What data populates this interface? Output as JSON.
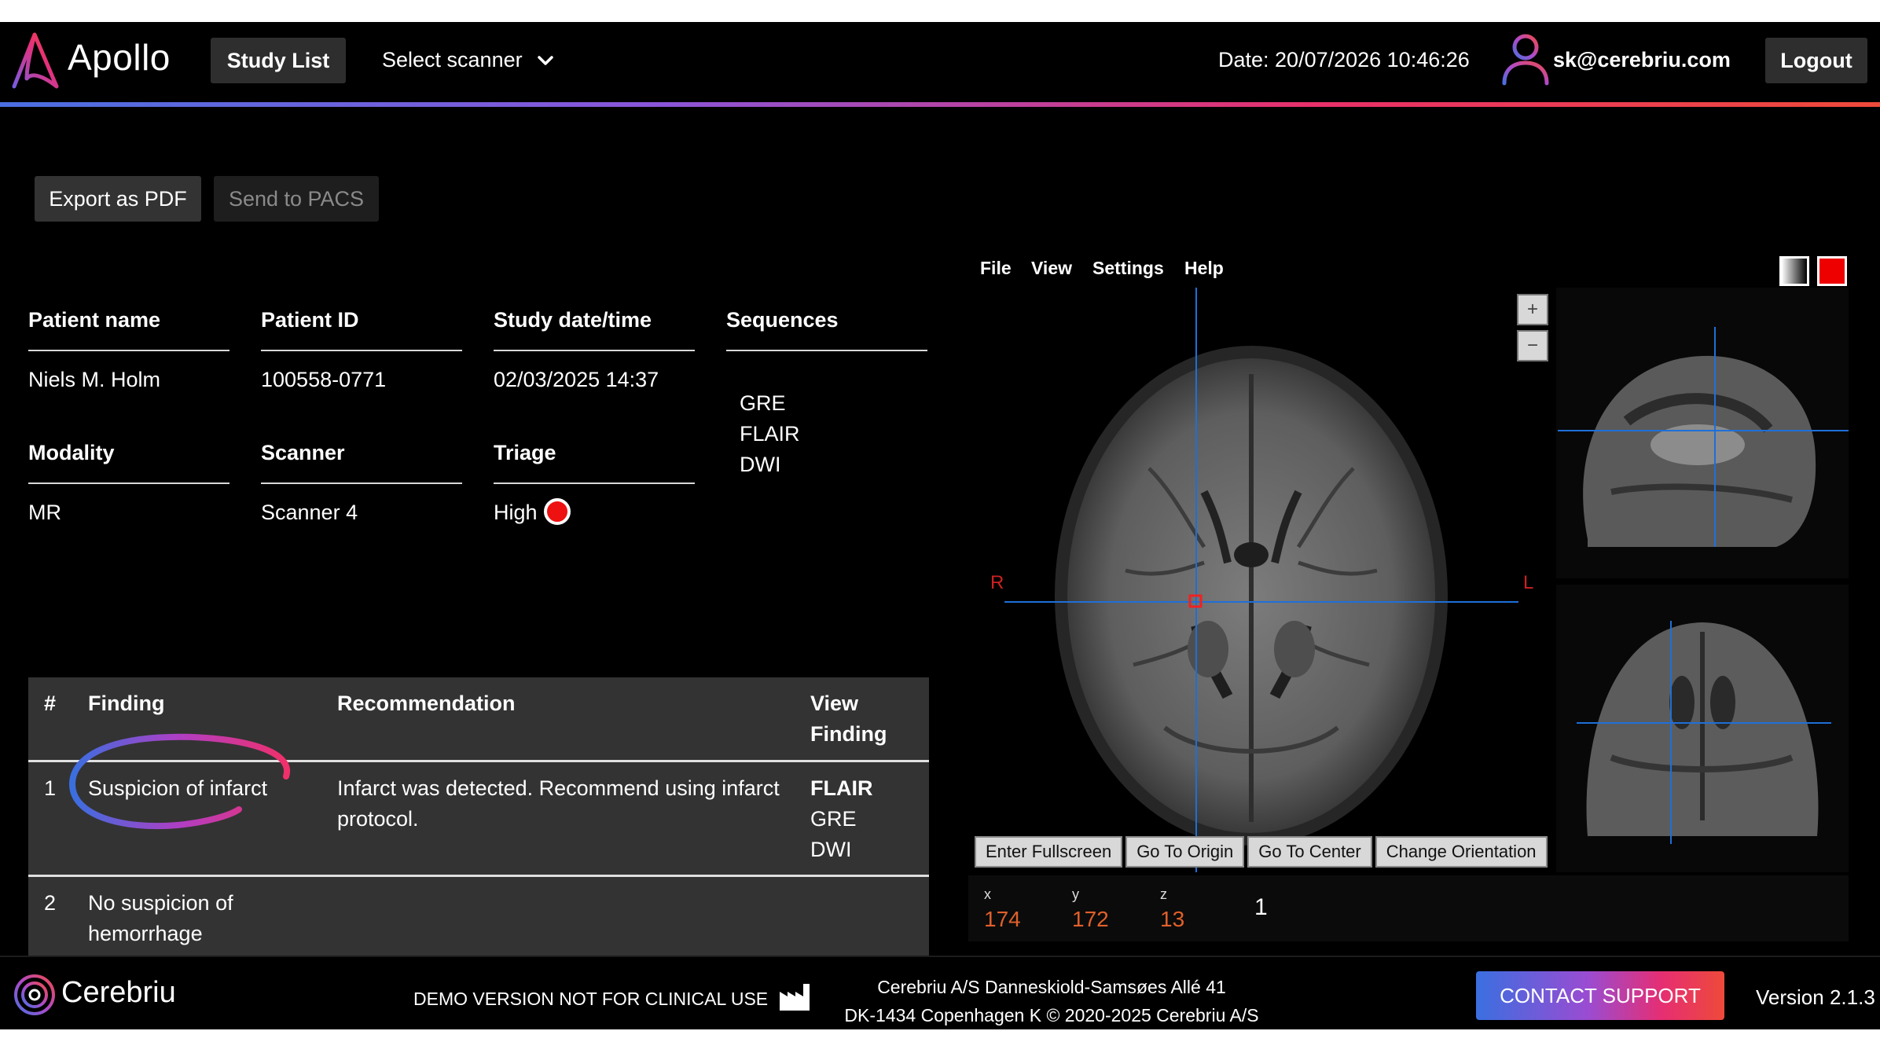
{
  "header": {
    "brand": "Apollo",
    "study_list_label": "Study List",
    "scanner_select_label": "Select scanner",
    "date_text": "Date: 20/07/2026 10:46:26",
    "user_email": "sk@cerebriu.com",
    "logout_label": "Logout"
  },
  "actions": {
    "export_pdf": "Export as PDF",
    "send_pacs": "Send to PACS"
  },
  "patient_info": {
    "patient_name_label": "Patient name",
    "patient_name": "Niels M. Holm",
    "patient_id_label": "Patient ID",
    "patient_id": "100558-0771",
    "study_datetime_label": "Study date/time",
    "study_datetime": "02/03/2025 14:37",
    "sequences_label": "Sequences",
    "sequences": [
      "GRE",
      "FLAIR",
      "DWI"
    ],
    "modality_label": "Modality",
    "modality": "MR",
    "scanner_label": "Scanner",
    "scanner": "Scanner 4",
    "triage_label": "Triage",
    "triage": "High",
    "triage_color": "#ee1111"
  },
  "findings_table": {
    "headers": [
      "#",
      "Finding",
      "Recommendation",
      "View Finding"
    ],
    "header_view_line1": "View",
    "header_view_line2": "Finding",
    "rows": [
      {
        "num": "1",
        "finding": "Suspicion of infarct",
        "recommendation_line1": "Infarct was detected. Recommend using infarct",
        "recommendation_line2": "protocol.",
        "views": [
          "FLAIR",
          "GRE",
          "DWI"
        ]
      },
      {
        "num": "2",
        "finding_line1": "No suspicion of",
        "finding_line2": "hemorrhage",
        "recommendation_line1": "",
        "recommendation_line2": "",
        "views": []
      }
    ]
  },
  "viewer": {
    "menu": [
      "File",
      "View",
      "Settings",
      "Help"
    ],
    "zoom_in": "+",
    "zoom_out": "−",
    "orientation_right": "R",
    "orientation_left": "L",
    "toolbar": [
      "Enter Fullscreen",
      "Go To Origin",
      "Go To Center",
      "Change Orientation"
    ],
    "coords": {
      "x_label": "x",
      "x": "174",
      "y_label": "y",
      "y": "172",
      "z_label": "z",
      "z": "13",
      "slice_value": "1"
    }
  },
  "footer": {
    "brand": "Cerebriu",
    "demo_notice": "DEMO VERSION NOT FOR CLINICAL USE",
    "address_line1": "Cerebriu A/S Danneskiold-Samsøes Allé 41",
    "address_line2": "DK-1434 Copenhagen K © 2020-2025 Cerebriu A/S",
    "contact_support": "CONTACT SUPPORT",
    "version": "Version 2.1.3"
  },
  "colors": {
    "accent_gradient_start": "#4a6fe0",
    "accent_gradient_end": "#ee4a3a",
    "crosshair": "#1e6fd8",
    "coord_value": "#e0602a"
  }
}
